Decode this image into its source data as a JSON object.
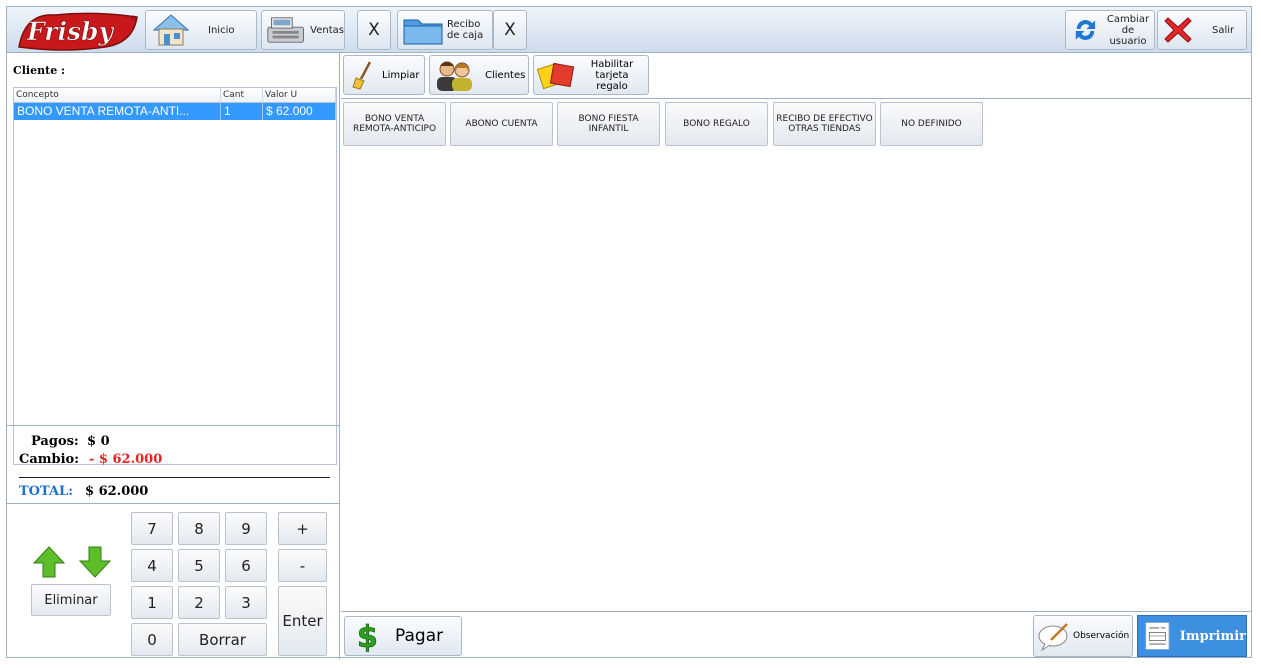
{
  "toolbar": {
    "logo_text": "Frisby",
    "inicio": "Inicio",
    "ventas": "Ventas",
    "ventas_close": "X",
    "recibo": "Recibo de caja",
    "recibo_close": "X",
    "cambiar_usuario": "Cambiar de usuario",
    "salir": "Salir"
  },
  "left": {
    "cliente_label": "Cliente :",
    "columns": [
      "Concepto",
      "Cant",
      "Valor U"
    ],
    "rows": [
      {
        "concepto": "BONO VENTA REMOTA-ANTI...",
        "cant": "1",
        "valor": "$ 62.000"
      }
    ],
    "pagos_label": "Pagos:",
    "pagos_value": "$ 0",
    "cambio_label": "Cambio:",
    "cambio_value": "- $ 62.000",
    "total_label": "TOTAL:",
    "total_value": "$ 62.000"
  },
  "keypad": {
    "keys": [
      "7",
      "8",
      "9",
      "4",
      "5",
      "6",
      "1",
      "2",
      "3",
      "0"
    ],
    "borrar": "Borrar",
    "plus": "+",
    "minus": "-",
    "enter": "Enter",
    "eliminar": "Eliminar"
  },
  "right_toolbar": {
    "limpiar": "Limpiar",
    "clientes": "Clientes",
    "habilitar": "Habilitar tarjeta regalo"
  },
  "concepts": [
    "BONO VENTA REMOTA-ANTICIPO",
    "ABONO CUENTA",
    "BONO FIESTA INFANTIL",
    "BONO REGALO",
    "RECIBO DE EFECTIVO OTRAS TIENDAS",
    "NO DEFINIDO"
  ],
  "bottom": {
    "pagar": "Pagar",
    "observacion": "Observación",
    "imprimir": "Imprimir"
  },
  "colors": {
    "selection": "#3399ff",
    "negative": "#e8211e",
    "total_label": "#1e6fd0",
    "imprimir": "#3d8fe0"
  }
}
